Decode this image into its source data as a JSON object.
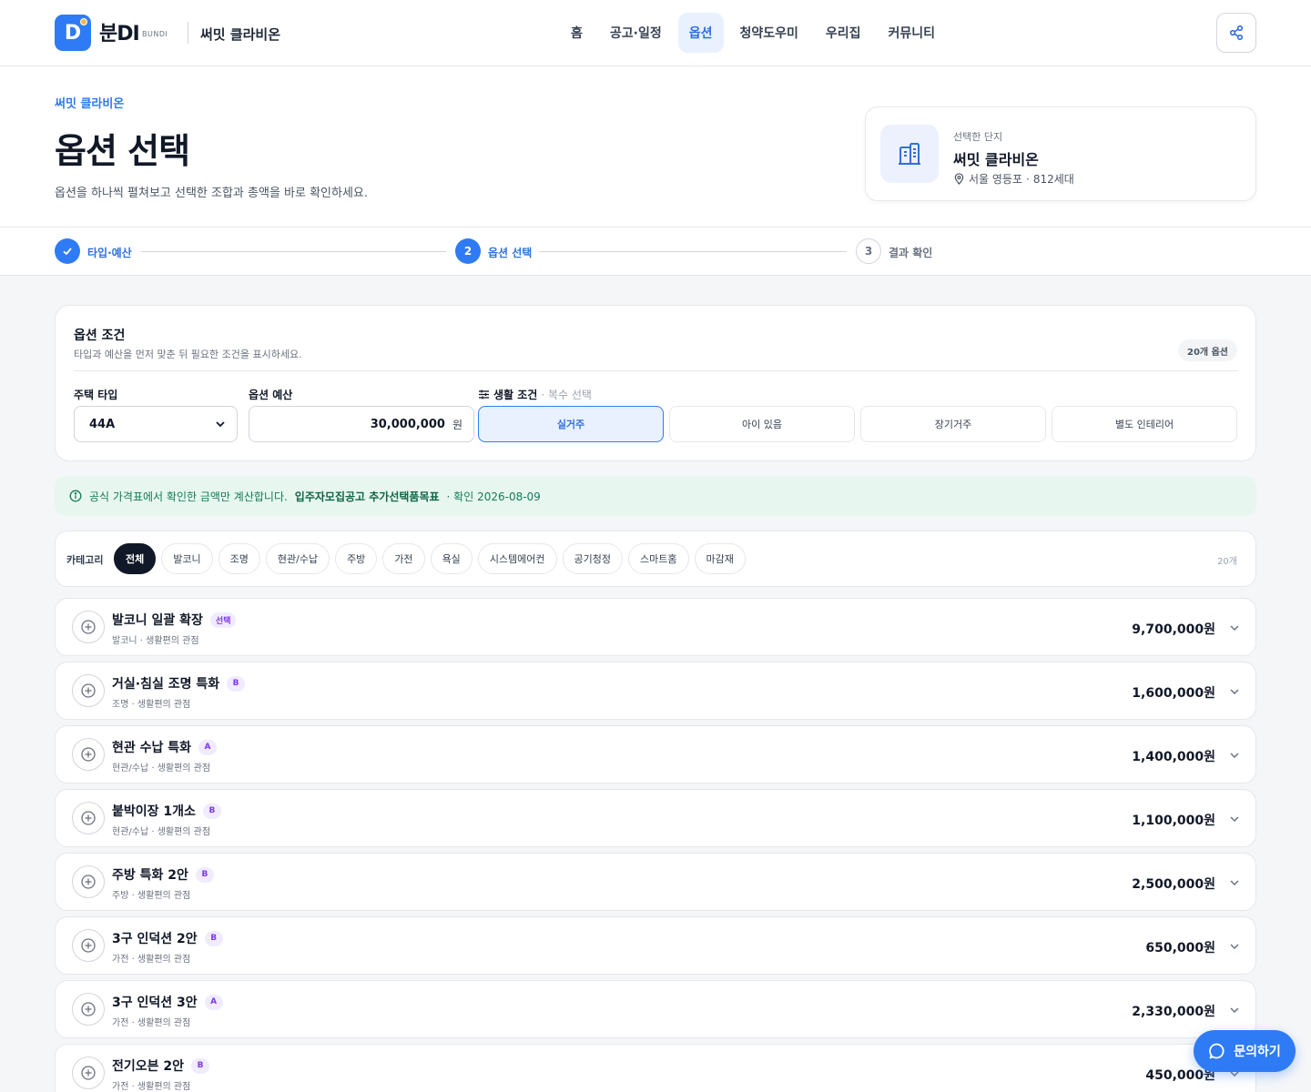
{
  "header": {
    "brand": "분DI",
    "brand_sub": "BUNDI",
    "complex": "써밋 클라비온",
    "nav": [
      "홈",
      "공고·일정",
      "옵션",
      "청약도우미",
      "우리집",
      "커뮤니티"
    ],
    "active_nav": "옵션",
    "icons": {
      "logo": "bundi-logo-icon",
      "share": "share-icon"
    }
  },
  "hero": {
    "eyebrow": "써밋 클라비온",
    "title": "옵션 선택",
    "description": "옵션을 하나씩 펼쳐보고 선택한 조합과 총액을 바로 확인하세요.",
    "complex_card": {
      "label": "선택한 단지",
      "name": "써밋 클라비온",
      "location": "서울 영등포",
      "units": "812세대"
    }
  },
  "stepper": {
    "steps": [
      {
        "num": "1",
        "label": "타입·예산",
        "state": "done"
      },
      {
        "num": "2",
        "label": "옵션 선택",
        "state": "current"
      },
      {
        "num": "3",
        "label": "결과 확인",
        "state": "todo"
      }
    ]
  },
  "conditions": {
    "title": "옵션 조건",
    "subtitle": "타입과 예산을 먼저 맞춘 뒤 필요한 조건을 표시하세요.",
    "option_count": "20개 옵션",
    "housing_type_label": "주택 타입",
    "housing_type_value": "44A",
    "budget_label": "옵션 예산",
    "budget_value": "30,000,000",
    "budget_unit": "원",
    "life_label": "생활 조건",
    "life_hint": "· 복수 선택",
    "life_options": [
      {
        "label": "실거주",
        "active": true
      },
      {
        "label": "아이 있음",
        "active": false
      },
      {
        "label": "장기거주",
        "active": false
      },
      {
        "label": "별도 인테리어",
        "active": false
      }
    ]
  },
  "notice": {
    "text": "공식 가격표에서 확인한 금액만 계산합니다.",
    "source": "입주자모집공고 추가선택품목표",
    "date": "· 확인 2026-08-09"
  },
  "categories": {
    "label": "카테고리",
    "items": [
      "전체",
      "발코니",
      "조명",
      "현관/수납",
      "주방",
      "가전",
      "욕실",
      "시스템에어컨",
      "공기청정",
      "스마트홈",
      "마감재"
    ],
    "active": "전체",
    "count": "20개"
  },
  "options": [
    {
      "name": "발코니 일괄 확장",
      "badge": "선택",
      "meta": "발코니 · 생활편의 관점",
      "price": "9,700,000원"
    },
    {
      "name": "거실·침실 조명 특화",
      "badge": "B",
      "meta": "조명 · 생활편의 관점",
      "price": "1,600,000원"
    },
    {
      "name": "현관 수납 특화",
      "badge": "A",
      "meta": "현관/수납 · 생활편의 관점",
      "price": "1,400,000원"
    },
    {
      "name": "붙박이장 1개소",
      "badge": "B",
      "meta": "현관/수납 · 생활편의 관점",
      "price": "1,100,000원"
    },
    {
      "name": "주방 특화 2안",
      "badge": "B",
      "meta": "주방 · 생활편의 관점",
      "price": "2,500,000원"
    },
    {
      "name": "3구 인덕션 2안",
      "badge": "B",
      "meta": "가전 · 생활편의 관점",
      "price": "650,000원"
    },
    {
      "name": "3구 인덕션 3안",
      "badge": "A",
      "meta": "가전 · 생활편의 관점",
      "price": "2,330,000원"
    },
    {
      "name": "전기오븐 2안",
      "badge": "B",
      "meta": "가전 · 생활편의 관점",
      "price": "450,000원"
    }
  ],
  "fab": {
    "label": "문의하기",
    "icon": "chat-icon"
  },
  "colors": {
    "primary": "#2f7bf5",
    "notice_bg": "#e7f7f0",
    "badge_purple": "#7c3aed"
  }
}
